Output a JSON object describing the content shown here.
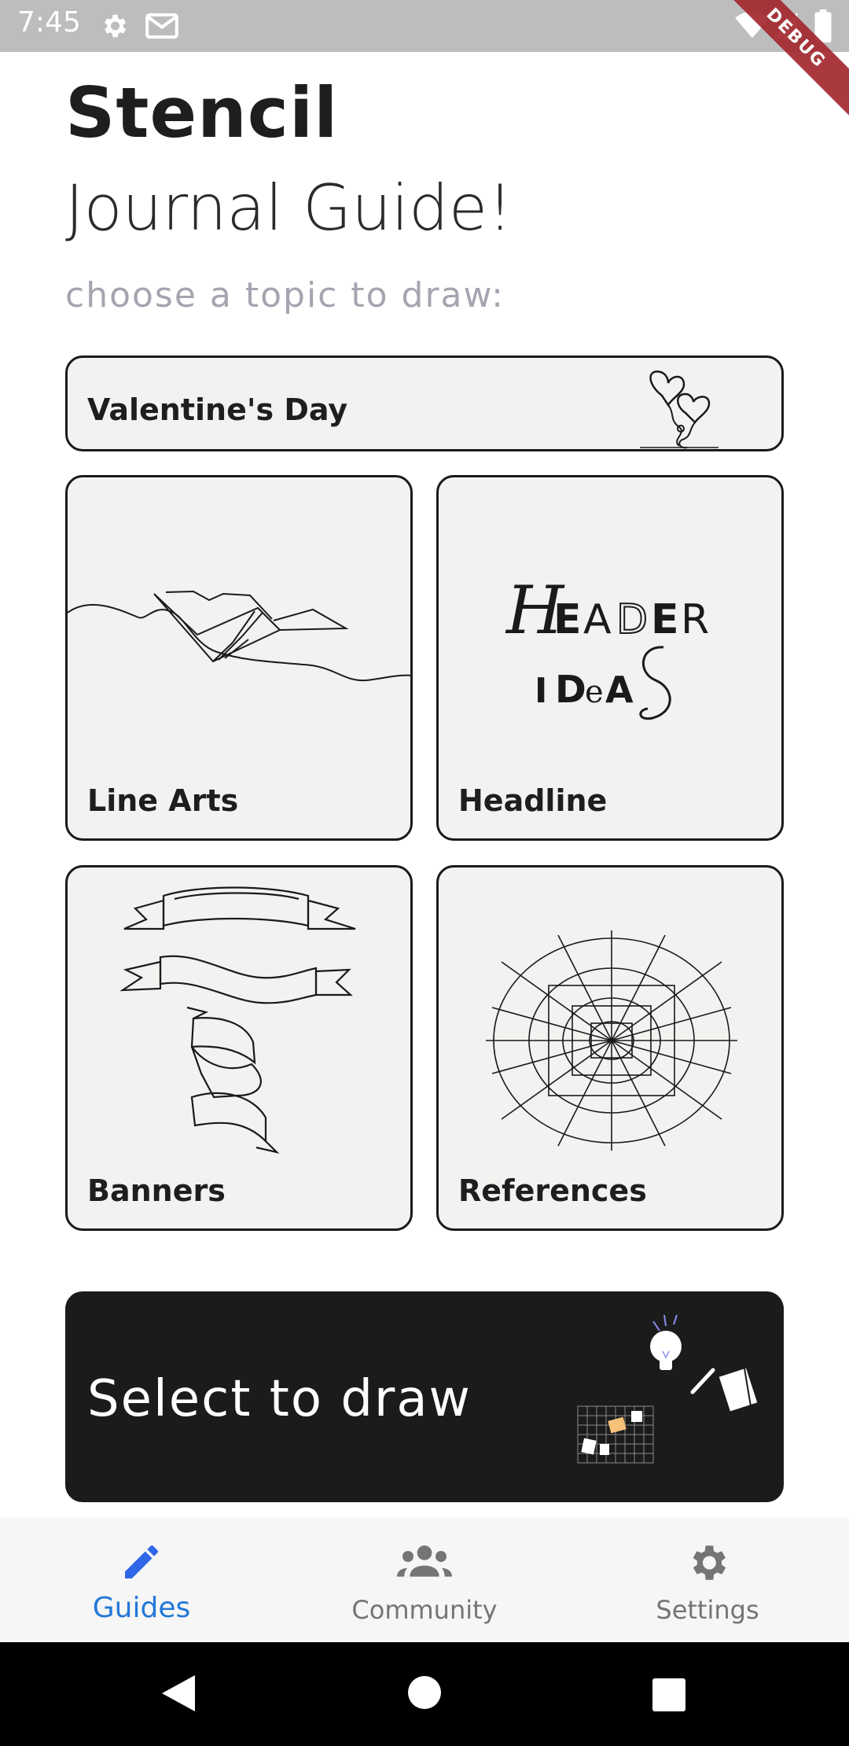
{
  "status_bar": {
    "time": "7:45",
    "icons": [
      "gear-icon",
      "gmail-icon",
      "wifi-icon",
      "signal-icon",
      "battery-icon"
    ],
    "debug_label": "DEBUG",
    "background": "#bdbdbd"
  },
  "header": {
    "title": "Stencil",
    "subtitle": "Journal Guide!",
    "prompt": "choose a topic to draw:"
  },
  "topics": [
    {
      "label": "Valentine's Day",
      "icon": "heart-balloons-illustration"
    },
    {
      "label": "Line Arts",
      "icon": "open-book-line-art"
    },
    {
      "label": "Headline",
      "icon": "header-ideas-lettering"
    },
    {
      "label": "Banners",
      "icon": "ribbon-banners-illustration"
    },
    {
      "label": "References",
      "icon": "perspective-grid-illustration"
    }
  ],
  "header_ideas_art": {
    "line1": "HEADER",
    "line2": "IDEAS"
  },
  "cta": {
    "label": "Select to draw",
    "background": "#1b1b1b"
  },
  "bottom_nav": {
    "items": [
      {
        "label": "Guides",
        "icon": "pencil-icon",
        "active": true
      },
      {
        "label": "Community",
        "icon": "group-icon",
        "active": false
      },
      {
        "label": "Settings",
        "icon": "gear-icon",
        "active": false
      }
    ],
    "active_color": "#2478d8",
    "inactive_color": "#757575"
  },
  "system_nav": {
    "icons": [
      "back-icon",
      "home-icon",
      "recents-icon"
    ]
  }
}
